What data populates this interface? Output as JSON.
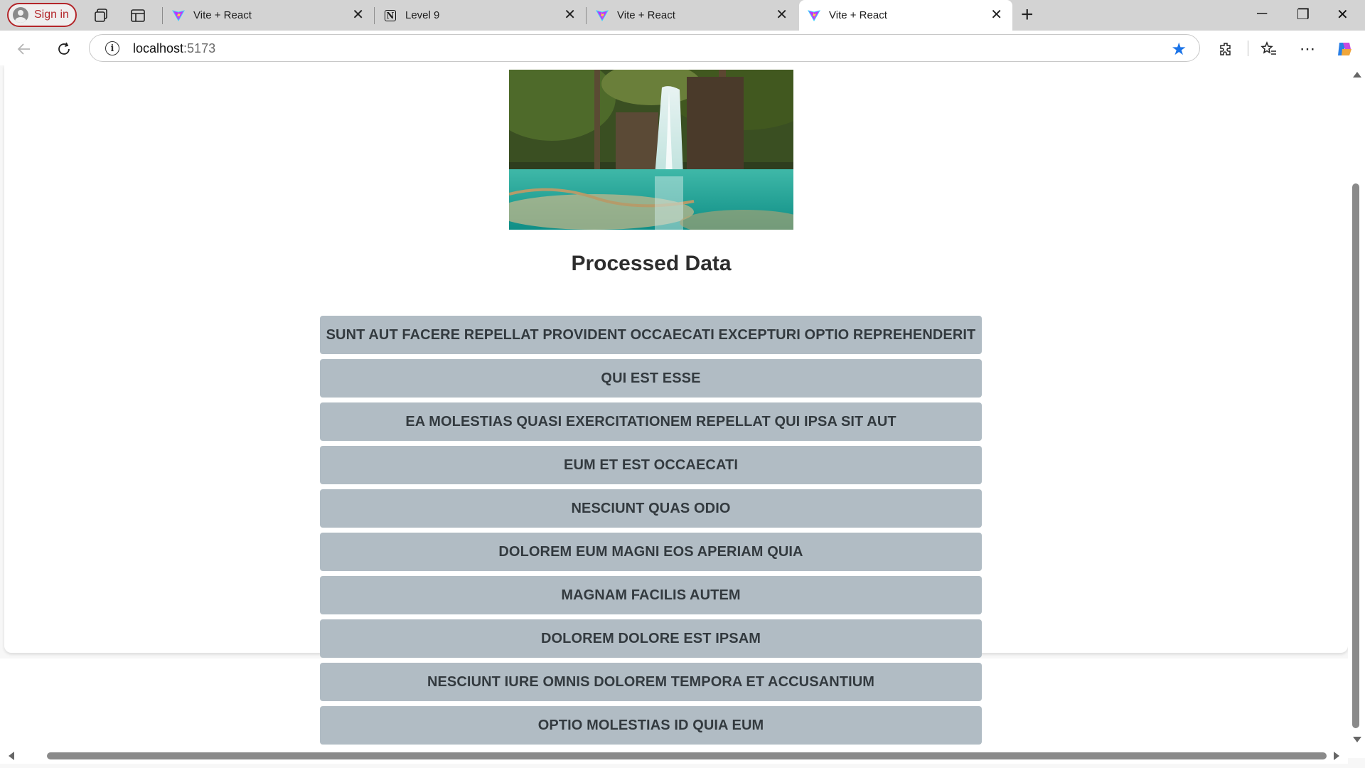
{
  "browser": {
    "signin_label": "Sign in",
    "tabs": [
      {
        "title": "Vite + React",
        "icon": "vite-icon",
        "active": false
      },
      {
        "title": "Level 9",
        "icon": "notion-icon",
        "active": false
      },
      {
        "title": "Vite + React",
        "icon": "vite-icon",
        "active": false
      },
      {
        "title": "Vite + React",
        "icon": "vite-icon",
        "active": true
      }
    ],
    "url_host": "localhost",
    "url_port": ":5173",
    "star_color": "#1a73e8"
  },
  "page": {
    "heading": "Processed Data",
    "items": [
      "SUNT AUT FACERE REPELLAT PROVIDENT OCCAECATI EXCEPTURI OPTIO REPREHENDERIT",
      "QUI EST ESSE",
      "EA MOLESTIAS QUASI EXERCITATIONEM REPELLAT QUI IPSA SIT AUT",
      "EUM ET EST OCCAECATI",
      "NESCIUNT QUAS ODIO",
      "DOLOREM EUM MAGNI EOS APERIAM QUIA",
      "MAGNAM FACILIS AUTEM",
      "DOLOREM DOLORE EST IPSAM",
      "NESCIUNT IURE OMNIS DOLOREM TEMPORA ET ACCUSANTIUM",
      "OPTIO MOLESTIAS ID QUIA EUM"
    ],
    "item_bg": "#b1bcc4"
  }
}
